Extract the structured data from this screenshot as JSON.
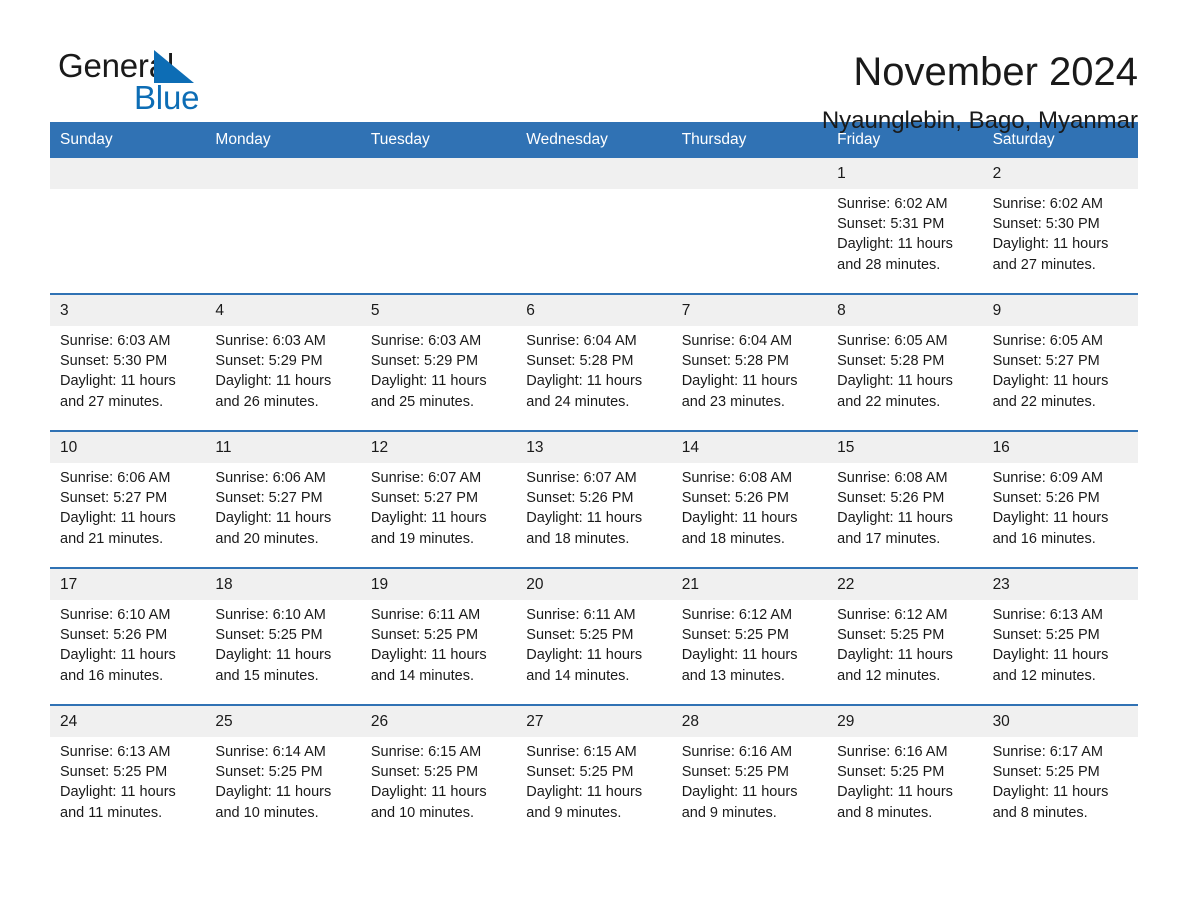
{
  "logo": {
    "word_general": "General",
    "word_blue": "Blue",
    "triangle_color": "#0d6db5"
  },
  "header": {
    "month_title": "November 2024",
    "location": "Nyaunglebin, Bago, Myanmar"
  },
  "theme": {
    "header_blue": "#3072b4",
    "date_band_gray": "#f0f0f0",
    "text": "#1a1a1a",
    "header_text": "#ffffff"
  },
  "weekday_headers": [
    "Sunday",
    "Monday",
    "Tuesday",
    "Wednesday",
    "Thursday",
    "Friday",
    "Saturday"
  ],
  "weeks": [
    {
      "days": [
        {
          "date": "",
          "lines": []
        },
        {
          "date": "",
          "lines": []
        },
        {
          "date": "",
          "lines": []
        },
        {
          "date": "",
          "lines": []
        },
        {
          "date": "",
          "lines": []
        },
        {
          "date": "1",
          "lines": [
            "Sunrise: 6:02 AM",
            "Sunset: 5:31 PM",
            "Daylight: 11 hours",
            "and 28 minutes."
          ]
        },
        {
          "date": "2",
          "lines": [
            "Sunrise: 6:02 AM",
            "Sunset: 5:30 PM",
            "Daylight: 11 hours",
            "and 27 minutes."
          ]
        }
      ]
    },
    {
      "days": [
        {
          "date": "3",
          "lines": [
            "Sunrise: 6:03 AM",
            "Sunset: 5:30 PM",
            "Daylight: 11 hours",
            "and 27 minutes."
          ]
        },
        {
          "date": "4",
          "lines": [
            "Sunrise: 6:03 AM",
            "Sunset: 5:29 PM",
            "Daylight: 11 hours",
            "and 26 minutes."
          ]
        },
        {
          "date": "5",
          "lines": [
            "Sunrise: 6:03 AM",
            "Sunset: 5:29 PM",
            "Daylight: 11 hours",
            "and 25 minutes."
          ]
        },
        {
          "date": "6",
          "lines": [
            "Sunrise: 6:04 AM",
            "Sunset: 5:28 PM",
            "Daylight: 11 hours",
            "and 24 minutes."
          ]
        },
        {
          "date": "7",
          "lines": [
            "Sunrise: 6:04 AM",
            "Sunset: 5:28 PM",
            "Daylight: 11 hours",
            "and 23 minutes."
          ]
        },
        {
          "date": "8",
          "lines": [
            "Sunrise: 6:05 AM",
            "Sunset: 5:28 PM",
            "Daylight: 11 hours",
            "and 22 minutes."
          ]
        },
        {
          "date": "9",
          "lines": [
            "Sunrise: 6:05 AM",
            "Sunset: 5:27 PM",
            "Daylight: 11 hours",
            "and 22 minutes."
          ]
        }
      ]
    },
    {
      "days": [
        {
          "date": "10",
          "lines": [
            "Sunrise: 6:06 AM",
            "Sunset: 5:27 PM",
            "Daylight: 11 hours",
            "and 21 minutes."
          ]
        },
        {
          "date": "11",
          "lines": [
            "Sunrise: 6:06 AM",
            "Sunset: 5:27 PM",
            "Daylight: 11 hours",
            "and 20 minutes."
          ]
        },
        {
          "date": "12",
          "lines": [
            "Sunrise: 6:07 AM",
            "Sunset: 5:27 PM",
            "Daylight: 11 hours",
            "and 19 minutes."
          ]
        },
        {
          "date": "13",
          "lines": [
            "Sunrise: 6:07 AM",
            "Sunset: 5:26 PM",
            "Daylight: 11 hours",
            "and 18 minutes."
          ]
        },
        {
          "date": "14",
          "lines": [
            "Sunrise: 6:08 AM",
            "Sunset: 5:26 PM",
            "Daylight: 11 hours",
            "and 18 minutes."
          ]
        },
        {
          "date": "15",
          "lines": [
            "Sunrise: 6:08 AM",
            "Sunset: 5:26 PM",
            "Daylight: 11 hours",
            "and 17 minutes."
          ]
        },
        {
          "date": "16",
          "lines": [
            "Sunrise: 6:09 AM",
            "Sunset: 5:26 PM",
            "Daylight: 11 hours",
            "and 16 minutes."
          ]
        }
      ]
    },
    {
      "days": [
        {
          "date": "17",
          "lines": [
            "Sunrise: 6:10 AM",
            "Sunset: 5:26 PM",
            "Daylight: 11 hours",
            "and 16 minutes."
          ]
        },
        {
          "date": "18",
          "lines": [
            "Sunrise: 6:10 AM",
            "Sunset: 5:25 PM",
            "Daylight: 11 hours",
            "and 15 minutes."
          ]
        },
        {
          "date": "19",
          "lines": [
            "Sunrise: 6:11 AM",
            "Sunset: 5:25 PM",
            "Daylight: 11 hours",
            "and 14 minutes."
          ]
        },
        {
          "date": "20",
          "lines": [
            "Sunrise: 6:11 AM",
            "Sunset: 5:25 PM",
            "Daylight: 11 hours",
            "and 14 minutes."
          ]
        },
        {
          "date": "21",
          "lines": [
            "Sunrise: 6:12 AM",
            "Sunset: 5:25 PM",
            "Daylight: 11 hours",
            "and 13 minutes."
          ]
        },
        {
          "date": "22",
          "lines": [
            "Sunrise: 6:12 AM",
            "Sunset: 5:25 PM",
            "Daylight: 11 hours",
            "and 12 minutes."
          ]
        },
        {
          "date": "23",
          "lines": [
            "Sunrise: 6:13 AM",
            "Sunset: 5:25 PM",
            "Daylight: 11 hours",
            "and 12 minutes."
          ]
        }
      ]
    },
    {
      "days": [
        {
          "date": "24",
          "lines": [
            "Sunrise: 6:13 AM",
            "Sunset: 5:25 PM",
            "Daylight: 11 hours",
            "and 11 minutes."
          ]
        },
        {
          "date": "25",
          "lines": [
            "Sunrise: 6:14 AM",
            "Sunset: 5:25 PM",
            "Daylight: 11 hours",
            "and 10 minutes."
          ]
        },
        {
          "date": "26",
          "lines": [
            "Sunrise: 6:15 AM",
            "Sunset: 5:25 PM",
            "Daylight: 11 hours",
            "and 10 minutes."
          ]
        },
        {
          "date": "27",
          "lines": [
            "Sunrise: 6:15 AM",
            "Sunset: 5:25 PM",
            "Daylight: 11 hours",
            "and 9 minutes."
          ]
        },
        {
          "date": "28",
          "lines": [
            "Sunrise: 6:16 AM",
            "Sunset: 5:25 PM",
            "Daylight: 11 hours",
            "and 9 minutes."
          ]
        },
        {
          "date": "29",
          "lines": [
            "Sunrise: 6:16 AM",
            "Sunset: 5:25 PM",
            "Daylight: 11 hours",
            "and 8 minutes."
          ]
        },
        {
          "date": "30",
          "lines": [
            "Sunrise: 6:17 AM",
            "Sunset: 5:25 PM",
            "Daylight: 11 hours",
            "and 8 minutes."
          ]
        }
      ]
    }
  ]
}
